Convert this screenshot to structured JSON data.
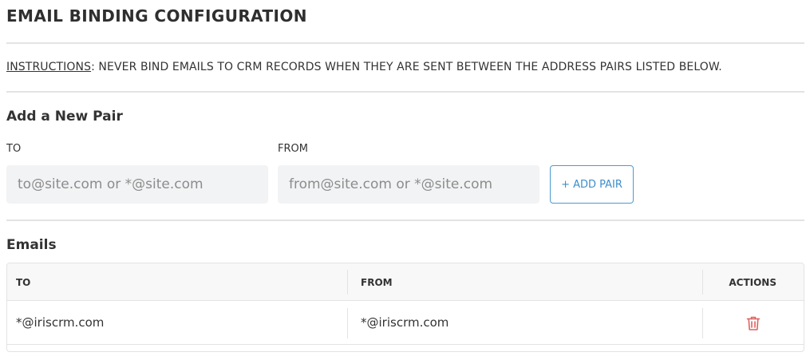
{
  "page": {
    "title": "EMAIL BINDING CONFIGURATION",
    "instructions_label": "INSTRUCTIONS",
    "instructions_text": ": NEVER BIND EMAILS TO CRM RECORDS WHEN THEY ARE SENT BETWEEN THE ADDRESS PAIRS LISTED BELOW."
  },
  "add_pair": {
    "section_title": "Add a New Pair",
    "to_label": "TO",
    "from_label": "FROM",
    "to_placeholder": "to@site.com or *@site.com",
    "from_placeholder": "from@site.com or *@site.com",
    "to_value": "",
    "from_value": "",
    "button_label": "+ ADD PAIR"
  },
  "emails": {
    "section_title": "Emails",
    "columns": {
      "to": "TO",
      "from": "FROM",
      "actions": "ACTIONS"
    },
    "rows": [
      {
        "to": "*@iriscrm.com",
        "from": "*@iriscrm.com",
        "action_icon": "trash-icon"
      }
    ]
  },
  "colors": {
    "accent": "#3c8fc9",
    "delete": "#e06060",
    "input_bg": "#f2f3f4",
    "divider": "#e3e3e3"
  }
}
